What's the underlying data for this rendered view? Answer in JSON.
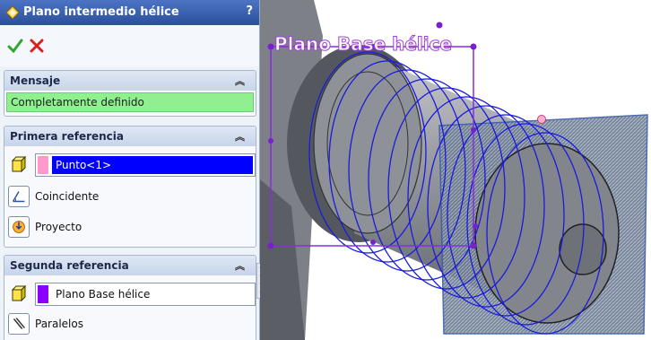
{
  "panel": {
    "title": "Plano intermedio hélice",
    "help": "?",
    "groups": {
      "mensaje": {
        "title": "Mensaje",
        "message": "Completamente definido"
      },
      "primera": {
        "title": "Primera referencia",
        "selection": "Punto<1>",
        "selection_color": "#ff99cc",
        "options": [
          "Coincidente",
          "Proyecto"
        ]
      },
      "segunda": {
        "title": "Segunda referencia",
        "selection": "Plano  Base hélice",
        "selection_color": "#8a00ff",
        "options": [
          "Paralelos"
        ]
      }
    }
  },
  "viewport": {
    "plane_label": "Plano  Base hélice"
  },
  "colors": {
    "title_bar": "#2f57a8",
    "message_bg": "#8ef08e",
    "selection_field_active": "#0000ff",
    "plane_label": "#a040e0",
    "helix": "#1a1adc",
    "cylinder": "#8a8c94"
  },
  "icons": {
    "title": "plane-feature-icon",
    "ok": "checkmark-icon",
    "cancel": "x-icon",
    "collapse": "chevron-up-icon",
    "selection": "yellow-cube-icon",
    "coincident": "coincident-icon",
    "project": "project-icon",
    "parallel": "parallel-icon"
  }
}
